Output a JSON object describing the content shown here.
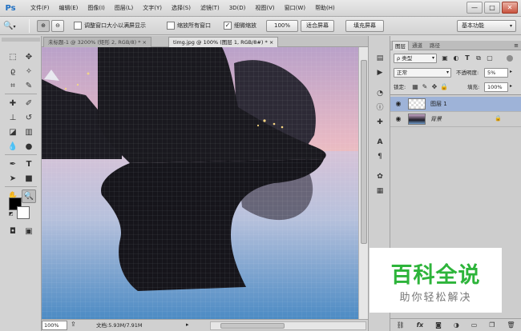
{
  "app": {
    "logo": "Ps"
  },
  "menu": [
    "文件(F)",
    "编辑(E)",
    "图像(I)",
    "图层(L)",
    "文字(Y)",
    "选择(S)",
    "滤镜(T)",
    "3D(D)",
    "视图(V)",
    "窗口(W)",
    "帮助(H)"
  ],
  "window_controls": {
    "minimize": "—",
    "maximize": "□",
    "close": "✕"
  },
  "options": {
    "tool_icon": "zoom-icon",
    "resize_windows_label": "调整窗口大小以满屏显示",
    "zoom_all_label": "缩放所有窗口",
    "scrubby_label": "细微缩放",
    "actual_pixels": "100%",
    "fit_screen": "适合屏幕",
    "fill_screen": "填充屏幕",
    "workspace": "基本功能"
  },
  "tabs": [
    {
      "label": "未标题-1 @ 3200% (矩形 2, RGB/8) *",
      "close": "×"
    },
    {
      "label": "timg.jpg @ 100% (图层 1, RGB/8#) *",
      "close": "×"
    }
  ],
  "status": {
    "zoom": "100%",
    "doc_info": "文档:5.93M/7.91M"
  },
  "layers_panel": {
    "tabs": [
      "图层",
      "通道",
      "路径"
    ],
    "filter": "ρ 类型",
    "blend_mode": "正常",
    "opacity_label": "不透明度:",
    "opacity_value": "5%",
    "lock_label": "锁定:",
    "fill_label": "填充:",
    "fill_value": "100%",
    "layers": [
      {
        "name": "图层 1",
        "selected": true,
        "visible": true
      },
      {
        "name": "背景",
        "selected": false,
        "visible": true,
        "locked": true
      }
    ],
    "footer_icons": [
      "link-icon",
      "fx-icon",
      "mask-icon",
      "adjustment-icon",
      "group-icon",
      "new-layer-icon",
      "trash-icon"
    ]
  },
  "watermark": {
    "title": "百科全说",
    "subtitle": "助你轻松解决"
  },
  "colors": {
    "accent": "#1e6fc2",
    "selection": "#9eb3d8",
    "watermark_green": "#2db43a"
  }
}
